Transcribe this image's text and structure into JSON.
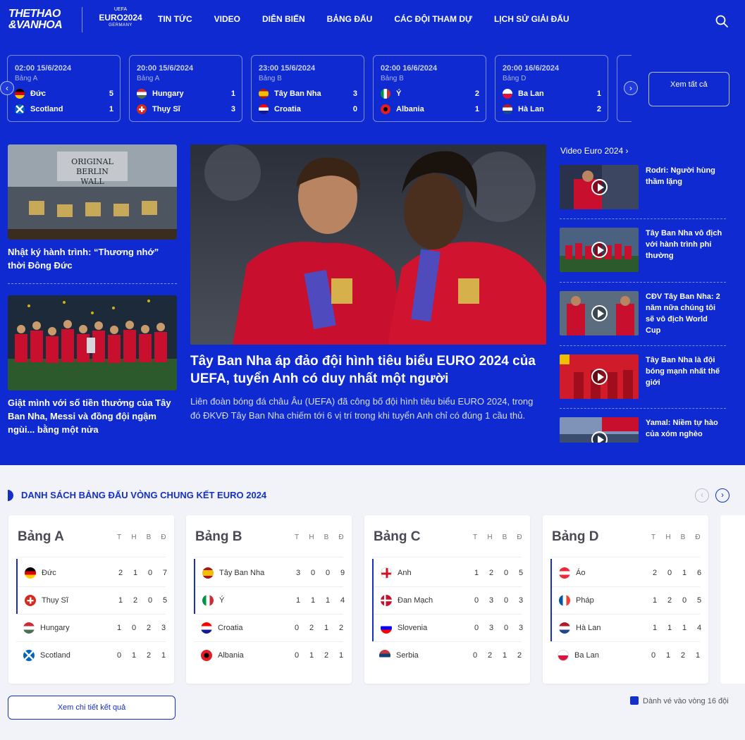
{
  "header": {
    "logo_line1": "THETHAO",
    "logo_line2": "&VANHOA",
    "euro_logo": {
      "uefa": "UEFA",
      "euro": "EURO2024",
      "germany": "GERMANY"
    },
    "nav": [
      "TIN TỨC",
      "VIDEO",
      "DIỄN BIẾN",
      "BẢNG ĐẤU",
      "CÁC ĐỘI THAM DỰ",
      "LỊCH SỬ GIẢI ĐẤU"
    ],
    "search_icon": "search-icon"
  },
  "matches": [
    {
      "time": "02:00 15/6/2024",
      "group": "Bảng A",
      "home": "Đức",
      "home_score": "5",
      "away": "Scotland",
      "away_score": "1"
    },
    {
      "time": "20:00 15/6/2024",
      "group": "Bảng A",
      "home": "Hungary",
      "home_score": "1",
      "away": "Thụy Sĩ",
      "away_score": "3"
    },
    {
      "time": "23:00 15/6/2024",
      "group": "Bảng B",
      "home": "Tây Ban Nha",
      "home_score": "3",
      "away": "Croatia",
      "away_score": "0"
    },
    {
      "time": "02:00 16/6/2024",
      "group": "Bảng B",
      "home": "Ý",
      "home_score": "2",
      "away": "Albania",
      "away_score": "1"
    },
    {
      "time": "20:00 16/6/2024",
      "group": "Bảng D",
      "home": "Ba Lan",
      "home_score": "1",
      "away": "Hà Lan",
      "away_score": "2"
    }
  ],
  "matches_see_all": "Xem tất cả",
  "side_stories": [
    {
      "title": "Nhật ký hành trình: “Thương nhớ” thời Đông Đức"
    },
    {
      "title": "Giật mình với số tiền thưởng của Tây Ban Nha, Messi và đồng đội ngậm ngùi... bằng một nửa"
    }
  ],
  "main_story": {
    "title": "Tây Ban Nha áp đảo đội hình tiêu biểu EURO 2024 của UEFA, tuyển Anh có duy nhất một người",
    "description": "Liên đoàn bóng đá châu Âu (UEFA) đã công bố đội hình tiêu biểu EURO 2024, trong đó ĐKVĐ Tây Ban Nha chiếm tới 6 vị trí trong khi tuyển Anh chỉ có đúng 1 cầu thủ."
  },
  "video_section": {
    "heading": "Video Euro 2024 ›",
    "items": [
      {
        "title": "Rodri: Người hùng thầm lặng"
      },
      {
        "title": "Tây Ban Nha vô địch với hành trình phi thường"
      },
      {
        "title": "CĐV Tây Ban Nha: 2 năm nữa chúng tôi sẽ vô địch World Cup"
      },
      {
        "title": "Tây Ban Nha là đội bóng mạnh nhất thế giới"
      },
      {
        "title": "Yamal: Niềm tự hào của xóm nghèo"
      }
    ]
  },
  "standings": {
    "title": "DANH SÁCH BẢNG ĐẤU VÒNG CHUNG KẾT EURO 2024",
    "columns": [
      "T",
      "H",
      "B",
      "Đ"
    ],
    "groups": [
      {
        "name": "Bảng A",
        "rows": [
          {
            "team": "Đức",
            "t": "2",
            "h": "1",
            "b": "0",
            "d": "7",
            "qualified": true
          },
          {
            "team": "Thụy Sĩ",
            "t": "1",
            "h": "2",
            "b": "0",
            "d": "5",
            "qualified": true
          },
          {
            "team": "Hungary",
            "t": "1",
            "h": "0",
            "b": "2",
            "d": "3",
            "qualified": false
          },
          {
            "team": "Scotland",
            "t": "0",
            "h": "1",
            "b": "2",
            "d": "1",
            "qualified": false
          }
        ]
      },
      {
        "name": "Bảng B",
        "rows": [
          {
            "team": "Tây Ban Nha",
            "t": "3",
            "h": "0",
            "b": "0",
            "d": "9",
            "qualified": true
          },
          {
            "team": "Ý",
            "t": "1",
            "h": "1",
            "b": "1",
            "d": "4",
            "qualified": true
          },
          {
            "team": "Croatia",
            "t": "0",
            "h": "2",
            "b": "1",
            "d": "2",
            "qualified": false
          },
          {
            "team": "Albania",
            "t": "0",
            "h": "1",
            "b": "2",
            "d": "1",
            "qualified": false
          }
        ]
      },
      {
        "name": "Bảng C",
        "rows": [
          {
            "team": "Anh",
            "t": "1",
            "h": "2",
            "b": "0",
            "d": "5",
            "qualified": true
          },
          {
            "team": "Đan Mạch",
            "t": "0",
            "h": "3",
            "b": "0",
            "d": "3",
            "qualified": true
          },
          {
            "team": "Slovenia",
            "t": "0",
            "h": "3",
            "b": "0",
            "d": "3",
            "qualified": true
          },
          {
            "team": "Serbia",
            "t": "0",
            "h": "2",
            "b": "1",
            "d": "2",
            "qualified": false
          }
        ]
      },
      {
        "name": "Bảng D",
        "rows": [
          {
            "team": "Áo",
            "t": "2",
            "h": "0",
            "b": "1",
            "d": "6",
            "qualified": true
          },
          {
            "team": "Pháp",
            "t": "1",
            "h": "2",
            "b": "0",
            "d": "5",
            "qualified": true
          },
          {
            "team": "Hà Lan",
            "t": "1",
            "h": "1",
            "b": "1",
            "d": "4",
            "qualified": true
          },
          {
            "team": "Ba Lan",
            "t": "0",
            "h": "1",
            "b": "2",
            "d": "1",
            "qualified": false
          }
        ]
      }
    ],
    "more_button": "Xem chi tiết kết quả",
    "legend": "Dành vé vào vòng 16 đội"
  },
  "colors": {
    "brand_blue": "#0e2ad0",
    "accent_blue": "#1530c8",
    "spain_red": "#c8102e"
  }
}
